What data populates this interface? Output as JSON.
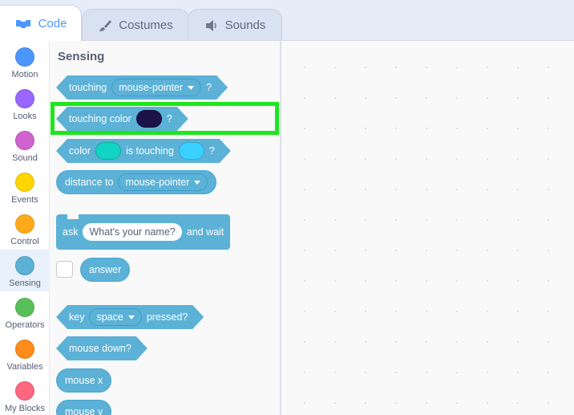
{
  "tabs": [
    {
      "label": "Code",
      "icon": "code-icon"
    },
    {
      "label": "Costumes",
      "icon": "brush-icon"
    },
    {
      "label": "Sounds",
      "icon": "speaker-icon"
    }
  ],
  "categories": [
    {
      "label": "Motion",
      "color": "#4c97ff"
    },
    {
      "label": "Looks",
      "color": "#9966ff"
    },
    {
      "label": "Sound",
      "color": "#cf63cf"
    },
    {
      "label": "Events",
      "color": "#ffd500"
    },
    {
      "label": "Control",
      "color": "#ffab19"
    },
    {
      "label": "Sensing",
      "color": "#5cb1d6",
      "selected": true
    },
    {
      "label": "Operators",
      "color": "#59c059"
    },
    {
      "label": "Variables",
      "color": "#ff8c1a"
    },
    {
      "label": "My Blocks",
      "color": "#ff6680"
    }
  ],
  "palette": {
    "title": "Sensing",
    "touching": {
      "label": "touching",
      "menu": "mouse-pointer",
      "suffix": "?"
    },
    "touching_color": {
      "label": "touching color",
      "suffix": "?",
      "swatch": "#1a1248"
    },
    "color_touching": {
      "label": "color",
      "middle": "is touching",
      "suffix": "?",
      "swatch1": "#12d4c2",
      "swatch2": "#3ad0ff"
    },
    "distance": {
      "label": "distance to",
      "menu": "mouse-pointer"
    },
    "ask": {
      "label": "ask",
      "input": "What's your name?",
      "suffix": "and wait"
    },
    "answer": {
      "label": "answer"
    },
    "key": {
      "label": "key",
      "menu": "space",
      "suffix": "pressed?"
    },
    "mouse_down": {
      "label": "mouse down?"
    },
    "mouse_x": {
      "label": "mouse x"
    },
    "mouse_y": {
      "label": "mouse y"
    }
  },
  "colors": {
    "highlight": "#1de61d",
    "sensing_block": "#5cb1d6",
    "accent": "#4c97ff"
  }
}
